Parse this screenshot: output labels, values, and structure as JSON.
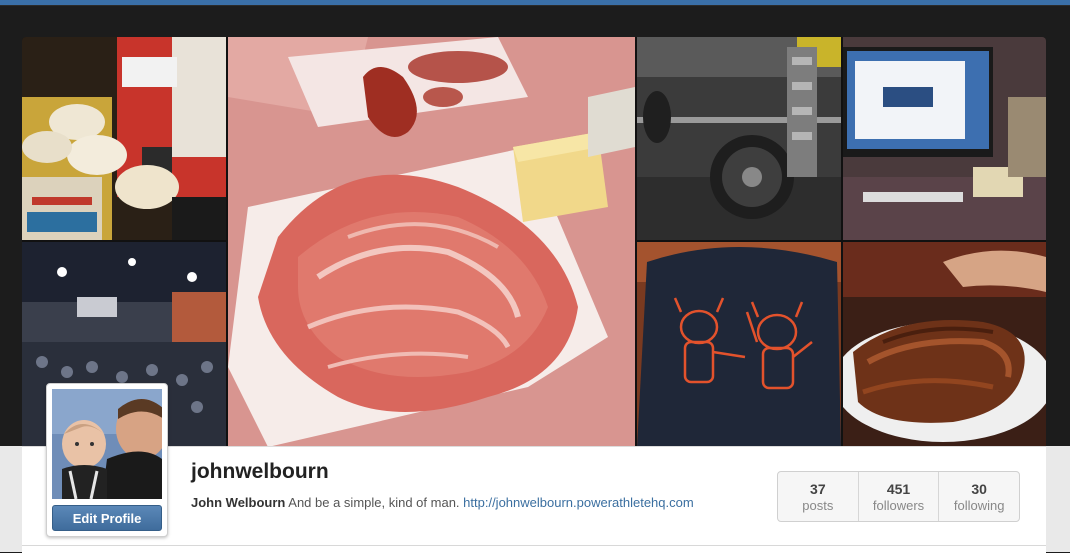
{
  "profile": {
    "username": "johnwelbourn",
    "full_name": "John Welbourn",
    "bio": " And be a simple, kind of man. ",
    "website": "http://johnwelbourn.powerathletehq.com",
    "edit_button_label": "Edit Profile"
  },
  "stats": [
    {
      "count": "37",
      "label": "posts"
    },
    {
      "count": "451",
      "label": "followers"
    },
    {
      "count": "30",
      "label": "following"
    }
  ],
  "photos": [
    {
      "subject": "coconut-oil-and-tortillas"
    },
    {
      "subject": "prosciutto-and-butter"
    },
    {
      "subject": "barbell-and-chains"
    },
    {
      "subject": "desktop-computer"
    },
    {
      "subject": "gym-crowd"
    },
    {
      "subject": "viking-tshirt"
    },
    {
      "subject": "grilled-meat"
    }
  ],
  "colors": {
    "accent_bar": "#3a6fa8",
    "button": "#4a7aab",
    "link": "#3b6fa0"
  }
}
